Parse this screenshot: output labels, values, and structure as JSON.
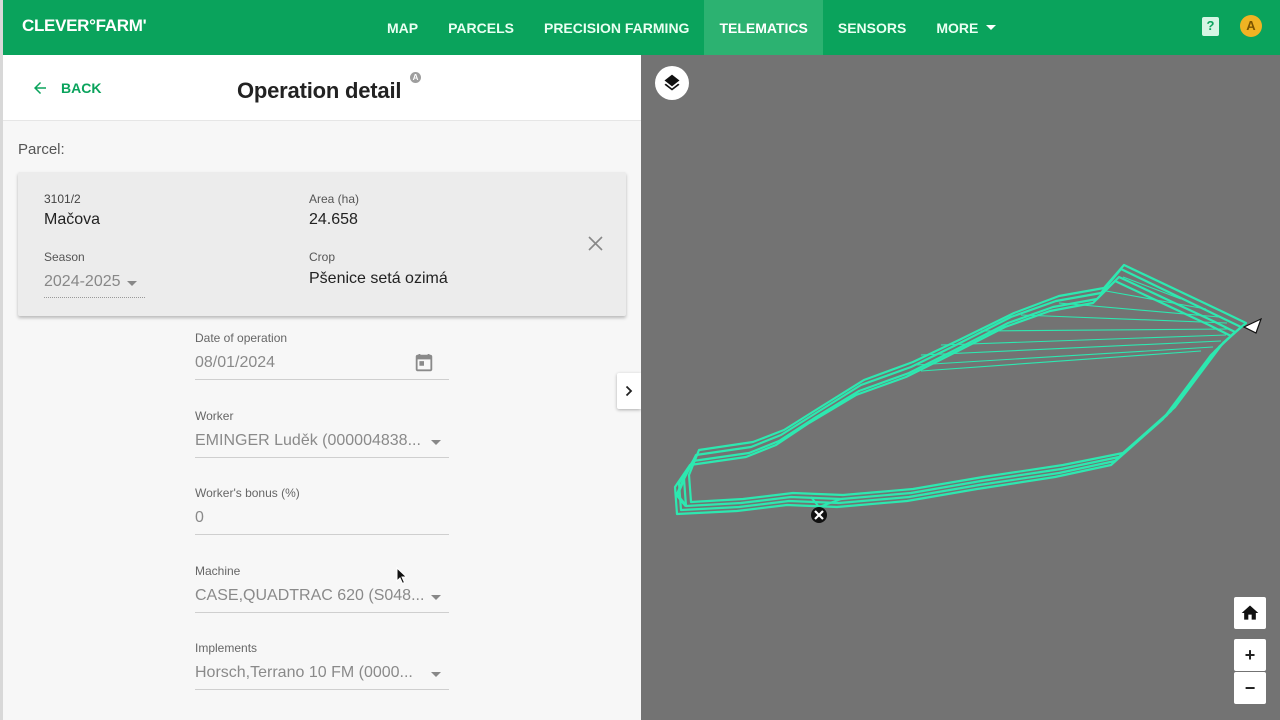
{
  "app": {
    "logo": "CLEVER°FARM'"
  },
  "nav": {
    "items": [
      {
        "label": "MAP"
      },
      {
        "label": "PARCELS"
      },
      {
        "label": "PRECISION FARMING"
      },
      {
        "label": "TELEMATICS",
        "active": true
      },
      {
        "label": "SENSORS"
      },
      {
        "label": "MORE"
      }
    ]
  },
  "header": {
    "help_icon": "?",
    "avatar_letter": "A"
  },
  "panel": {
    "back_label": "BACK",
    "title": "Operation detail",
    "info_badge": "A",
    "parcel_label": "Parcel:",
    "parcel": {
      "id": "3101/2",
      "name": "Mačova",
      "area_label": "Area (ha)",
      "area_value": "24.658",
      "season_label": "Season",
      "season_value": "2024-2025",
      "crop_label": "Crop",
      "crop_value": "Pšenice setá ozimá"
    },
    "fields": {
      "date_label": "Date of operation",
      "date_value": "08/01/2024",
      "worker_label": "Worker",
      "worker_value": "EMINGER Luděk (000004838...",
      "bonus_label": "Worker's bonus (%)",
      "bonus_value": "0",
      "machine_label": "Machine",
      "machine_value": "CASE,QUADTRAC 620 (S048...",
      "implements_label": "Implements",
      "implements_value": "Horsch,Terrano 10 FM (0000..."
    }
  },
  "map": {
    "background": "#737373",
    "track_color": "#2de8b0",
    "zoom_in": "+",
    "zoom_out": "−",
    "home_icon": "home-icon",
    "layers_icon": "layers-icon"
  },
  "colors": {
    "brand": "#0aa35c",
    "nav_active": "#2cb271"
  }
}
